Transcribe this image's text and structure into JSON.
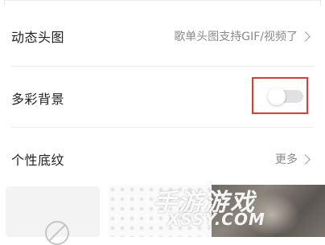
{
  "settings": {
    "rows": [
      {
        "label": "动态头图",
        "value": "歌单头图支持GIF/视频了"
      },
      {
        "label": "多彩背景",
        "toggle_on": false
      },
      {
        "label": "个性底纹",
        "value": "更多"
      }
    ]
  },
  "texture_options": [
    {
      "name": "none",
      "icon": "none-icon"
    },
    {
      "name": "hearts-pattern"
    },
    {
      "name": "photo"
    }
  ],
  "watermark": {
    "line1": "手游游戏",
    "line2": "XSSY.COM"
  },
  "colors": {
    "highlight": "#e53935",
    "toggle_off_track": "#e1e1e1",
    "secondary_text": "#8a8a8a"
  }
}
